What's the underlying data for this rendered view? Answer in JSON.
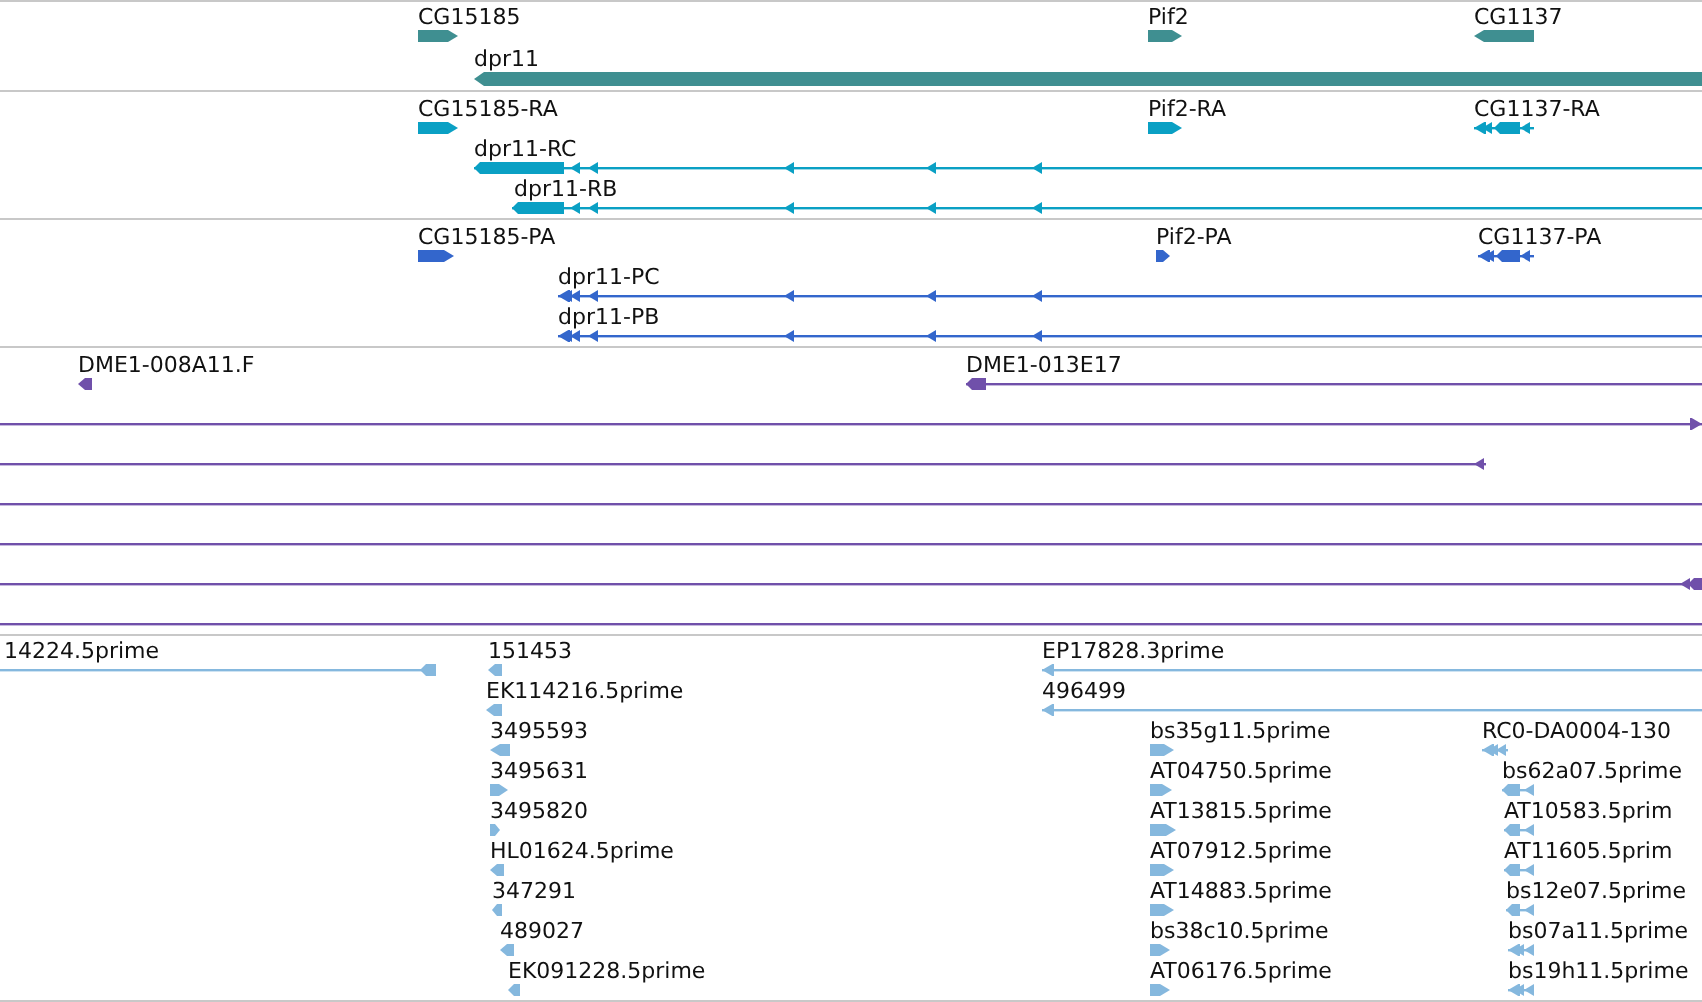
{
  "tracks": [
    {
      "features": [
        {
          "label": "CG15185",
          "reverse": false
        },
        {
          "label": "dpr11",
          "reverse": true
        },
        {
          "label": "Pif2",
          "reverse": false
        },
        {
          "label": "CG1137",
          "reverse": true
        }
      ]
    },
    {
      "features": [
        {
          "label": "CG15185-RA",
          "reverse": false
        },
        {
          "label": "dpr11-RC",
          "reverse": true
        },
        {
          "label": "dpr11-RB",
          "reverse": true
        },
        {
          "label": "Pif2-RA",
          "reverse": false
        },
        {
          "label": "CG1137-RA",
          "reverse": true
        }
      ]
    },
    {
      "features": [
        {
          "label": "CG15185-PA",
          "reverse": false
        },
        {
          "label": "dpr11-PC",
          "reverse": true
        },
        {
          "label": "dpr11-PB",
          "reverse": true
        },
        {
          "label": "Pif2-PA",
          "reverse": false
        },
        {
          "label": "CG1137-PA",
          "reverse": true
        }
      ]
    },
    {
      "features": [
        {
          "label": "DME1-008A11.F",
          "reverse": true
        },
        {
          "label": "DME1-013E17",
          "reverse": true
        },
        {
          "reverse": false
        },
        {
          "reverse": true
        },
        {
          "reverse": true
        }
      ]
    },
    {
      "features": [
        {
          "label": "14224.5prime",
          "reverse": true
        },
        {
          "label": "151453",
          "reverse": true
        },
        {
          "label": "EK114216.5prime",
          "reverse": true
        },
        {
          "label": "3495593",
          "reverse": true
        },
        {
          "label": "3495631",
          "reverse": false
        },
        {
          "label": "3495820",
          "reverse": false
        },
        {
          "label": "HL01624.5prime",
          "reverse": true
        },
        {
          "label": "347291",
          "reverse": true
        },
        {
          "label": "489027",
          "reverse": true
        },
        {
          "label": "EK091228.5prime",
          "reverse": true
        },
        {
          "label": "EP17828.3prime",
          "reverse": true
        },
        {
          "label": "496499",
          "reverse": true
        },
        {
          "label": "bs35g11.5prime",
          "reverse": false
        },
        {
          "label": "AT04750.5prime",
          "reverse": false
        },
        {
          "label": "AT13815.5prime",
          "reverse": false
        },
        {
          "label": "AT07912.5prime",
          "reverse": false
        },
        {
          "label": "AT14883.5prime",
          "reverse": false
        },
        {
          "label": "bs38c10.5prime",
          "reverse": false
        },
        {
          "label": "AT06176.5prime",
          "reverse": false
        },
        {
          "label": "RC0-DA0004-130",
          "reverse": true
        },
        {
          "label": "bs62a07.5prime",
          "reverse": true
        },
        {
          "label": "AT10583.5prim",
          "reverse": true
        },
        {
          "label": "AT11605.5prim",
          "reverse": true
        },
        {
          "label": "bs12e07.5prime",
          "reverse": true
        },
        {
          "label": "bs07a11.5prime",
          "reverse": true
        },
        {
          "label": "bs19h11.5prime",
          "reverse": true
        }
      ]
    }
  ]
}
